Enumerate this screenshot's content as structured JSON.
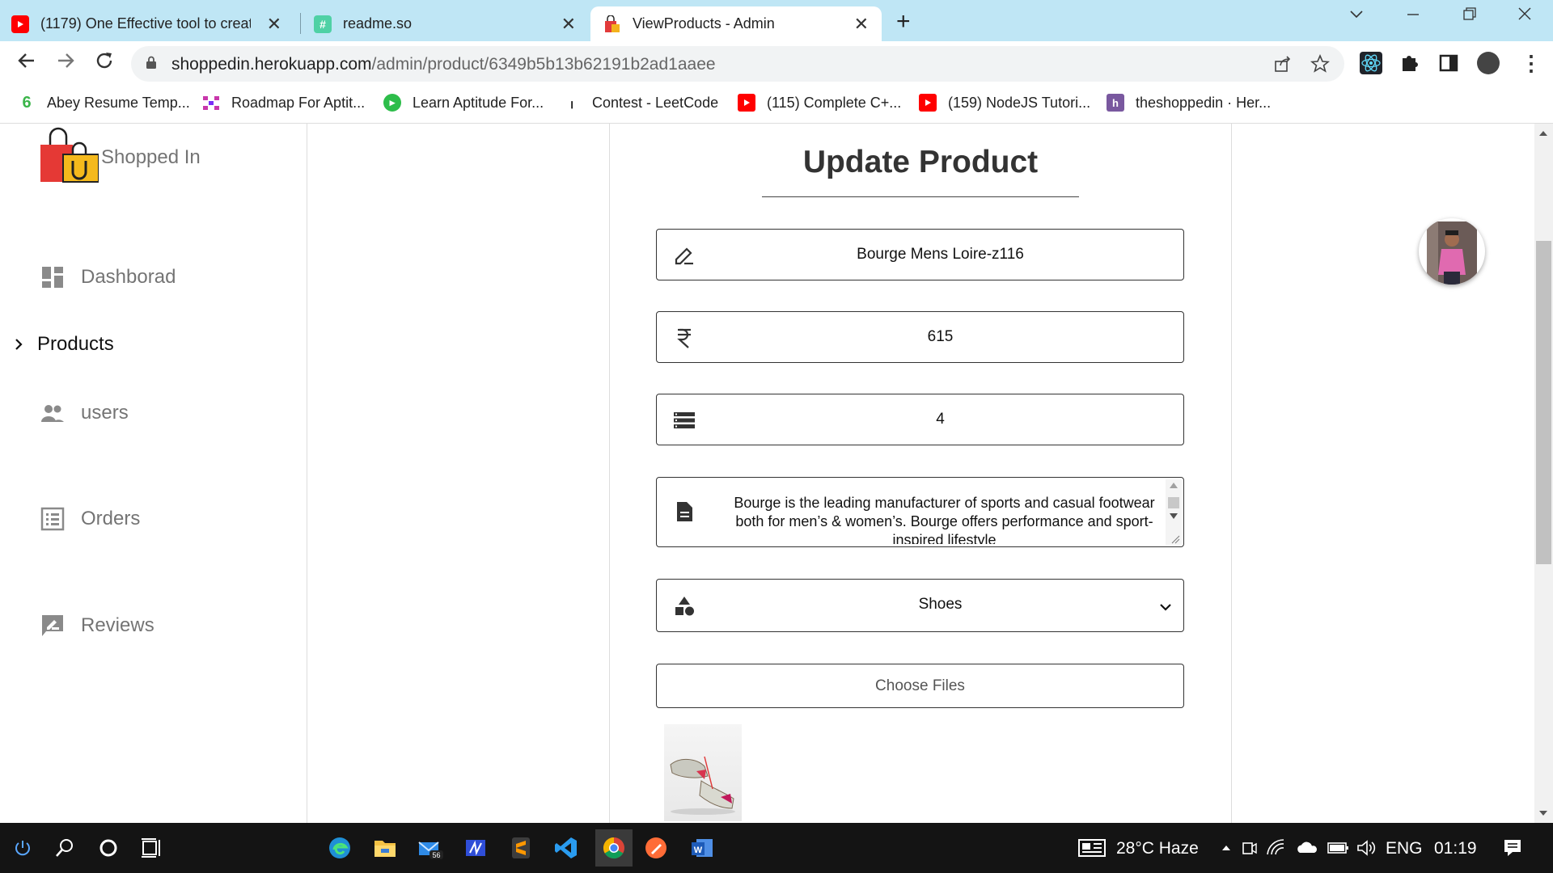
{
  "browser": {
    "tabs": [
      {
        "title": "(1179) One Effective tool to creat"
      },
      {
        "title": "readme.so"
      },
      {
        "title": "ViewProducts - Admin"
      }
    ],
    "url_host": "shoppedin.herokuapp.com",
    "url_path": "/admin/product/6349b5b13b62191b2ad1aaee",
    "bookmarks": [
      {
        "label": "Abey Resume Temp..."
      },
      {
        "label": "Roadmap For Aptit..."
      },
      {
        "label": "Learn Aptitude For..."
      },
      {
        "label": "Contest - LeetCode"
      },
      {
        "label": "(115) Complete C+..."
      },
      {
        "label": "(159) NodeJS Tutori..."
      },
      {
        "label": "theshoppedin · Her..."
      }
    ]
  },
  "sidebar": {
    "brand": "Shopped In",
    "items": [
      {
        "label": "Dashborad"
      },
      {
        "label": "Products"
      },
      {
        "label": "users"
      },
      {
        "label": "Orders"
      },
      {
        "label": "Reviews"
      }
    ]
  },
  "form": {
    "title": "Update Product",
    "name": "Bourge Mens Loire-z116",
    "price": "615",
    "stock": "4",
    "description": "Bourge is the leading manufacturer of sports and casual footwear both for men’s & women’s. Bourge offers performance and sport-inspired lifestyle",
    "category": "Shoes",
    "choose_files": "Choose Files"
  },
  "taskbar": {
    "weather": "28°C  Haze",
    "lang": "ENG",
    "time": "01:19",
    "badge": "56"
  },
  "colors": {
    "tab_strip": "#bfe6f5",
    "youtube_red": "#ff0000",
    "taskbar": "#141414"
  }
}
